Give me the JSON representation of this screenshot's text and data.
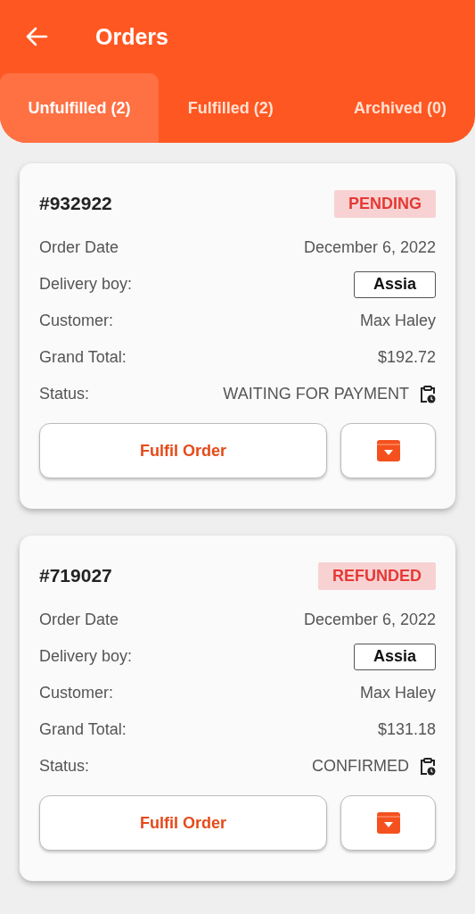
{
  "header": {
    "title": "Orders"
  },
  "tabs": [
    {
      "label": "Unfulfilled (2)",
      "selected": true
    },
    {
      "label": "Fulfilled (2)",
      "selected": false
    },
    {
      "label": "Archived (0)",
      "selected": false
    }
  ],
  "orders": [
    {
      "number": "#932922",
      "badge": "PENDING",
      "rows": [
        {
          "kind": "text",
          "label": "Order Date",
          "value": "December 6, 2022"
        },
        {
          "kind": "select",
          "label": "Delivery boy:",
          "value": "Assia"
        },
        {
          "kind": "text",
          "label": "Customer:",
          "value": "Max Haley"
        },
        {
          "kind": "text",
          "label": "Grand Total:",
          "value": "$192.72"
        },
        {
          "kind": "status",
          "label": "Status:",
          "value": "WAITING FOR PAYMENT"
        }
      ],
      "action": "Fulfil Order"
    },
    {
      "number": "#719027",
      "badge": "REFUNDED",
      "rows": [
        {
          "kind": "text",
          "label": "Order Date",
          "value": "December 6, 2022"
        },
        {
          "kind": "select",
          "label": "Delivery boy:",
          "value": "Assia"
        },
        {
          "kind": "text",
          "label": "Customer:",
          "value": "Max Haley"
        },
        {
          "kind": "text",
          "label": "Grand Total:",
          "value": "$131.18"
        },
        {
          "kind": "status",
          "label": "Status:",
          "value": "CONFIRMED"
        }
      ],
      "action": "Fulfil Order"
    }
  ]
}
